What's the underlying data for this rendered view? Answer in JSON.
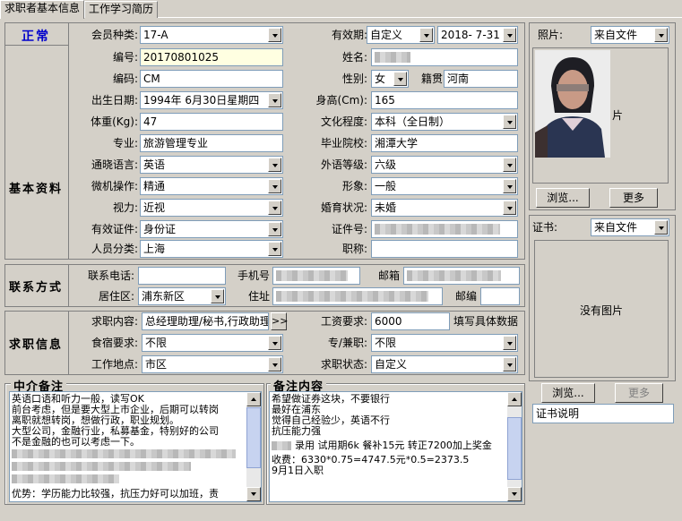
{
  "tabs": [
    "求职者基本信息",
    "工作学习简历"
  ],
  "status": "正常",
  "sections": {
    "basic": "基本资料",
    "contact": "联系方式",
    "job": "求职信息",
    "agent_notes": "中介备注",
    "notes": "备注内容"
  },
  "labels": {
    "member_type": "会员种类:",
    "validity": "有效期:",
    "number": "编号:",
    "name": "姓名:",
    "code": "编码:",
    "gender": "性别:",
    "origin": "籍贯",
    "birth": "出生日期:",
    "height": "身高(Cm):",
    "weight": "体重(Kg):",
    "education": "文化程度:",
    "major": "专业:",
    "school": "毕业院校:",
    "language": "通晓语言:",
    "foreign_level": "外语等级:",
    "computer": "微机操作:",
    "appearance": "形象:",
    "vision": "视力:",
    "marital": "婚育状况:",
    "id_type": "有效证件:",
    "id_no": "证件号:",
    "category": "人员分类:",
    "title": "职称:",
    "phone": "联系电话:",
    "mobile": "手机号",
    "email": "邮箱",
    "district": "居住区:",
    "address": "住址",
    "zip": "邮编",
    "job_content": "求职内容:",
    "salary": "工资要求:",
    "salary_hint": "填写具体数据",
    "board": "食宿要求:",
    "fulltime": "专/兼职:",
    "location": "工作地点:",
    "job_status": "求职状态:",
    "photo": "照片:",
    "certificate": "证书:"
  },
  "values": {
    "member_type": "17-A",
    "validity_mode": "自定义",
    "validity_date": "2018- 7-31",
    "number": "20170801025",
    "code": "CM",
    "gender": "女",
    "origin": "河南",
    "birth": "1994年 6月30日星期四",
    "height": "165",
    "weight": "47",
    "education": "本科（全日制）",
    "major": "旅游管理专业",
    "school": "湘潭大学",
    "language": "英语",
    "foreign_level": "六级",
    "computer": "精通",
    "appearance": "一般",
    "vision": "近视",
    "marital": "未婚",
    "id_type": "身份证",
    "category": "上海",
    "district": "浦东新区",
    "job_content": "总经理助理/秘书,行政助理",
    "expand_btn": ">>",
    "salary": "6000",
    "board": "不限",
    "fulltime": "不限",
    "location": "市区",
    "job_status": "自定义",
    "photo_source": "来自文件",
    "photo_overlay": "片",
    "cert_source": "来自文件",
    "no_image": "没有图片",
    "cert_desc": "证书说明"
  },
  "buttons": {
    "browse": "浏览...",
    "more": "更多",
    "browse2": "浏览...",
    "more2": "更多"
  },
  "agent_notes": [
    "英语口语和听力一般，读写OK",
    "前台考虑，但是要大型上市企业，后期可以转岗",
    "离职就想转岗，想做行政，职业规划。",
    "大型公司，金融行业，私募基金，特别好的公司",
    "不是金融的也可以考虑一下。",
    "",
    "",
    "优势：学历能力比较强，抗压力好可以加班，责"
  ],
  "notes": [
    "希望做证券这块，不要银行",
    "最好在浦东",
    "觉得自己经验少，英语不行",
    "抗压能力强",
    "",
    "录用  试用期6k  餐补15元  转正7200加上奖金",
    "",
    "收费：6330*0.75=4747.5元*0.5=2373.5",
    " 9月1日入职"
  ]
}
